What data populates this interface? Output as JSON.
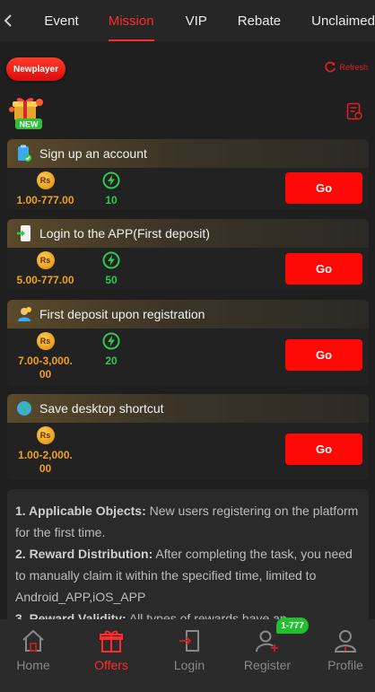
{
  "nav": {
    "tabs": [
      {
        "label": "Event"
      },
      {
        "label": "Mission"
      },
      {
        "label": "VIP"
      },
      {
        "label": "Rebate"
      },
      {
        "label": "Unclaimed"
      }
    ],
    "active_tab": "Mission"
  },
  "subheader": {
    "category_label": "Newplayer",
    "refresh_label": "Refresh",
    "badge_text": "NEW"
  },
  "tasks": [
    {
      "title": "Sign up an account",
      "coin_label": "Rs",
      "amount": "1.00-777.00",
      "xp": "10",
      "go_label": "Go"
    },
    {
      "title": "Login to the APP(First deposit)",
      "coin_label": "Rs",
      "amount": "5.00-777.00",
      "xp": "50",
      "go_label": "Go"
    },
    {
      "title": "First deposit upon registration",
      "coin_label": "Rs",
      "amount_line1": "7.00-3,000.",
      "amount_line2": "00",
      "xp": "20",
      "go_label": "Go"
    },
    {
      "title": "Save desktop shortcut",
      "coin_label": "Rs",
      "amount_line1": "1.00-2,000.",
      "amount_line2": "00",
      "go_label": "Go"
    }
  ],
  "rules": [
    {
      "heading": "1. Applicable Objects:",
      "text": " New users registering on the platform for the first time."
    },
    {
      "heading": "2. Reward Distribution:",
      "text": " After completing the task, you need to manually claim it within the specified time, limited to Android_APP,iOS_APP"
    },
    {
      "heading": "3. Reward Validity:",
      "text": " All types of rewards have an"
    }
  ],
  "bottom_nav": {
    "items": [
      {
        "label": "Home"
      },
      {
        "label": "Offers"
      },
      {
        "label": "Login"
      },
      {
        "label": "Register"
      },
      {
        "label": "Profile"
      }
    ],
    "active": "Offers",
    "register_badge": "1-777"
  },
  "colors": {
    "accent_red": "#ff0808",
    "coin_gold": "#f0a020",
    "xp_green": "#2fc850",
    "background": "#1f1f1f"
  },
  "icons": {
    "back": "chevron-left-icon",
    "refresh": "refresh-icon",
    "gift": "gift-badge-icon",
    "document": "document-icon",
    "rupee_coin": "rupee-coin-icon",
    "xp_bolt": "lightning-icon",
    "home": "home-icon",
    "offers": "gift-box-icon",
    "login": "login-icon",
    "register": "add-user-icon",
    "profile": "user-icon"
  }
}
